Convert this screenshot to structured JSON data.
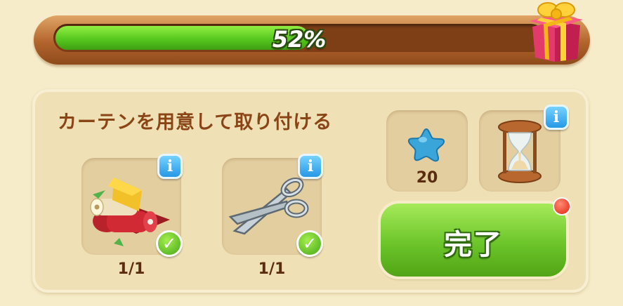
{
  "progress": {
    "percent_text": "52%",
    "fill_fraction": 0.52
  },
  "task": {
    "title": "カーテンを用意して取り付ける"
  },
  "requirements": [
    {
      "icon": "fabric-rolls-icon",
      "count": "1/1",
      "completed": true
    },
    {
      "icon": "scissors-icon",
      "count": "1/1",
      "completed": true
    }
  ],
  "rewards": {
    "star_count": "20",
    "star_icon": "blue-star-icon",
    "hourglass_icon": "hourglass-icon"
  },
  "actions": {
    "done_label": "完了"
  },
  "colors": {
    "accent_green": "#6cc52a",
    "title_brown": "#8a4517",
    "info_blue": "#2698e6",
    "alert_red": "#e3220f"
  }
}
